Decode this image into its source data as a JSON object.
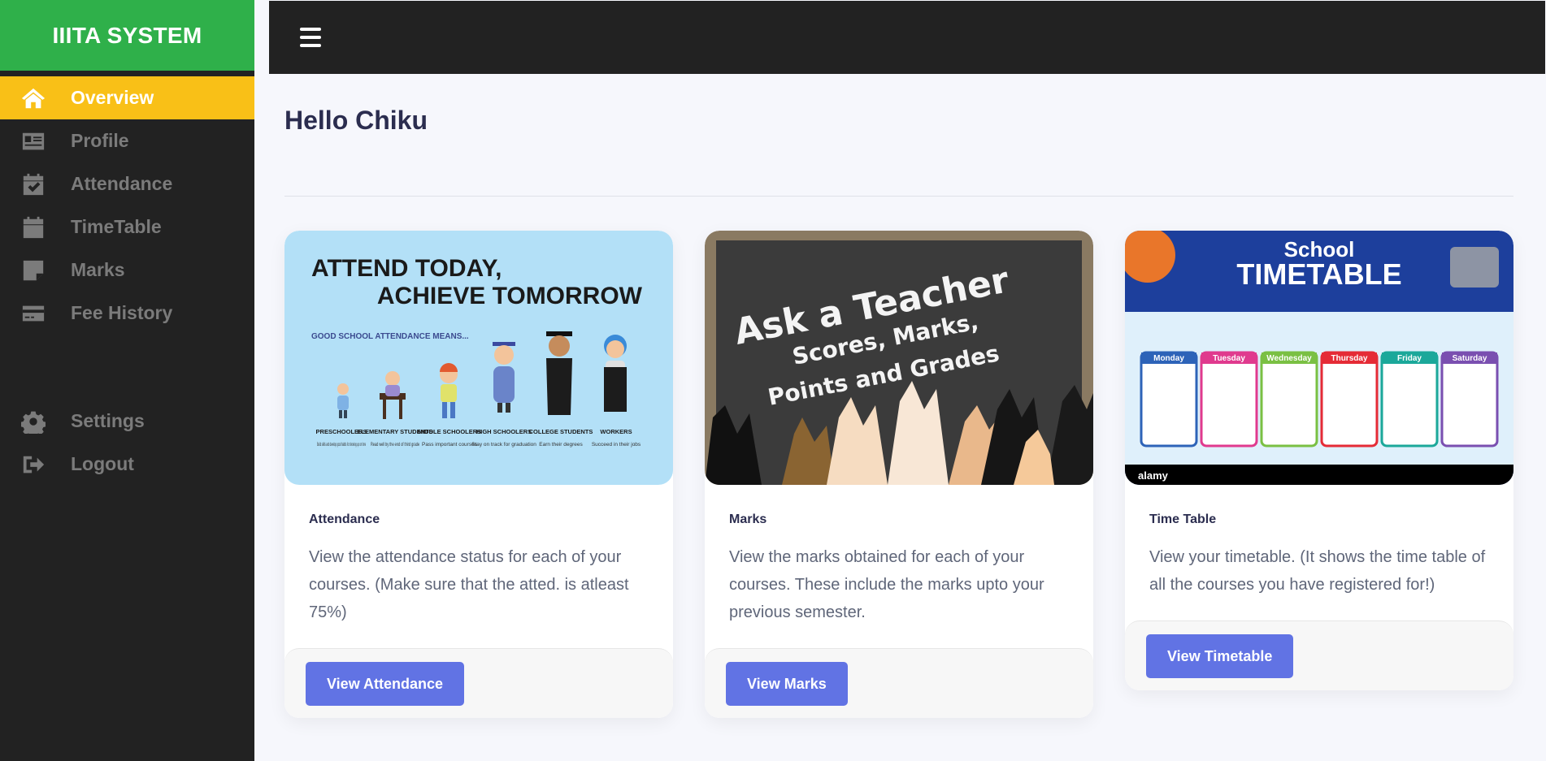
{
  "brand": "IIITA SYSTEM",
  "sidebar": {
    "items": [
      {
        "label": "Overview",
        "icon": "home-icon",
        "active": true
      },
      {
        "label": "Profile",
        "icon": "id-card-icon"
      },
      {
        "label": "Attendance",
        "icon": "calendar-check-icon"
      },
      {
        "label": "TimeTable",
        "icon": "calendar-icon"
      },
      {
        "label": "Marks",
        "icon": "sticky-note-icon"
      },
      {
        "label": "Fee History",
        "icon": "credit-card-icon"
      }
    ],
    "bottom_items": [
      {
        "label": "Settings",
        "icon": "gear-icon"
      },
      {
        "label": "Logout",
        "icon": "sign-out-icon"
      }
    ]
  },
  "main": {
    "greeting": "Hello Chiku",
    "cards": [
      {
        "title": "Attendance",
        "text": "View the attendance status for each of your courses. (Make sure that the atted. is atleast 75%)",
        "button": "View Attendance",
        "image": {
          "headline_1": "ATTEND TODAY,",
          "headline_2": "ACHIEVE TOMORROW",
          "subhead": "GOOD SCHOOL ATTENDANCE MEANS...",
          "groups": [
            {
              "name": "PRESCHOOLERS",
              "desc": "Build skills and develop good habits for showing up on time"
            },
            {
              "name": "ELEMENTARY STUDENTS",
              "desc": "Read well by the end of third grade"
            },
            {
              "name": "MIDDLE SCHOOLERS",
              "desc": "Pass important courses"
            },
            {
              "name": "HIGH SCHOOLERS",
              "desc": "Stay on track for graduation"
            },
            {
              "name": "COLLEGE STUDENTS",
              "desc": "Earn their degrees"
            },
            {
              "name": "WORKERS",
              "desc": "Succeed in their jobs"
            }
          ]
        }
      },
      {
        "title": "Marks",
        "text": "View the marks obtained for each of your courses. These include the marks upto your previous semester.",
        "button": "View Marks",
        "image": {
          "line_1": "Ask a Teacher",
          "line_2": "Scores, Marks,",
          "line_3": "Points and Grades"
        }
      },
      {
        "title": "Time Table",
        "text": "View your timetable. (It shows the time table of all the courses you have registered for!)",
        "button": "View Timetable",
        "image": {
          "line_1": "School",
          "line_2": "TIMETABLE",
          "days": [
            "Monday",
            "Tuesday",
            "Wednesday",
            "Thursday",
            "Friday",
            "Saturday"
          ],
          "watermark": "alamy"
        }
      }
    ]
  },
  "colors": {
    "brand_green": "#2fb04a",
    "active_yellow": "#f9c017",
    "sidebar_bg": "#222222",
    "button_blue": "#6173e4"
  }
}
